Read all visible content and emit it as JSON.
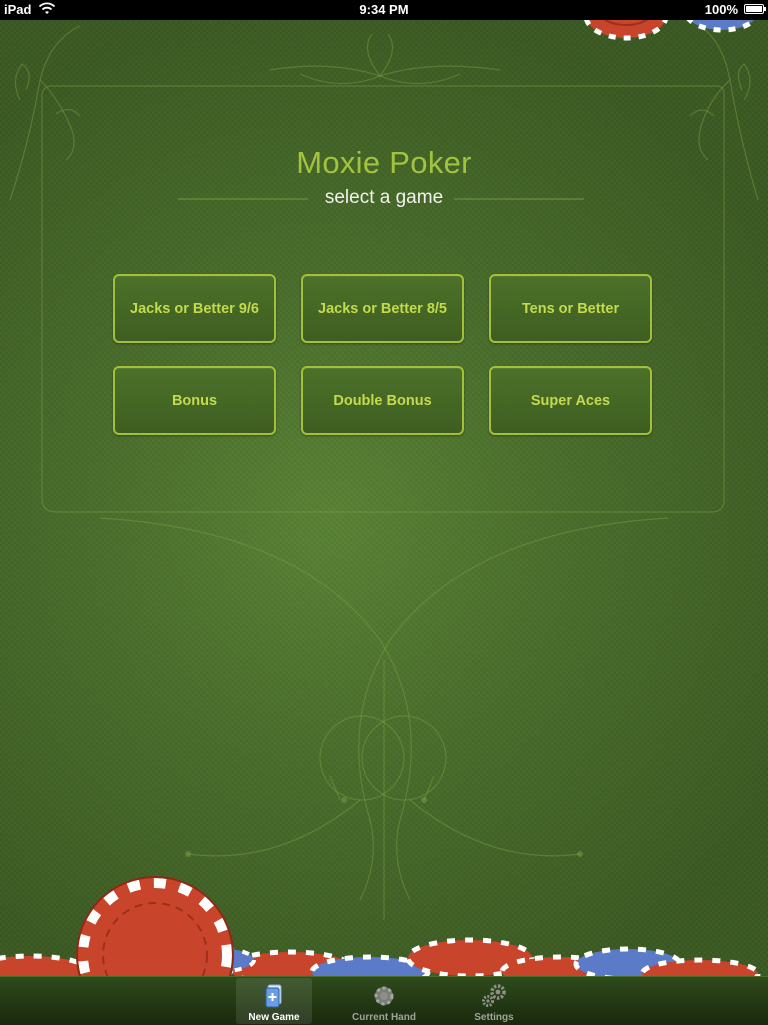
{
  "status_bar": {
    "device": "iPad",
    "time": "9:34 PM",
    "battery": "100%"
  },
  "header": {
    "title": "Moxie Poker",
    "subtitle": "select a game"
  },
  "games": [
    "Jacks or Better 9/6",
    "Jacks or Better 8/5",
    "Tens or Better",
    "Bonus",
    "Double Bonus",
    "Super Aces"
  ],
  "tabbar": {
    "tabs": [
      {
        "label": "New Game",
        "icon": "new-game-icon",
        "selected": true
      },
      {
        "label": "Current Hand",
        "icon": "chip-icon",
        "selected": false
      },
      {
        "label": "Settings",
        "icon": "gears-icon",
        "selected": false
      }
    ]
  },
  "colors": {
    "accent": "#a2c03a",
    "felt": "#4a6e2b",
    "chip_red": "#c8442a",
    "chip_blue": "#5b7bc9"
  }
}
